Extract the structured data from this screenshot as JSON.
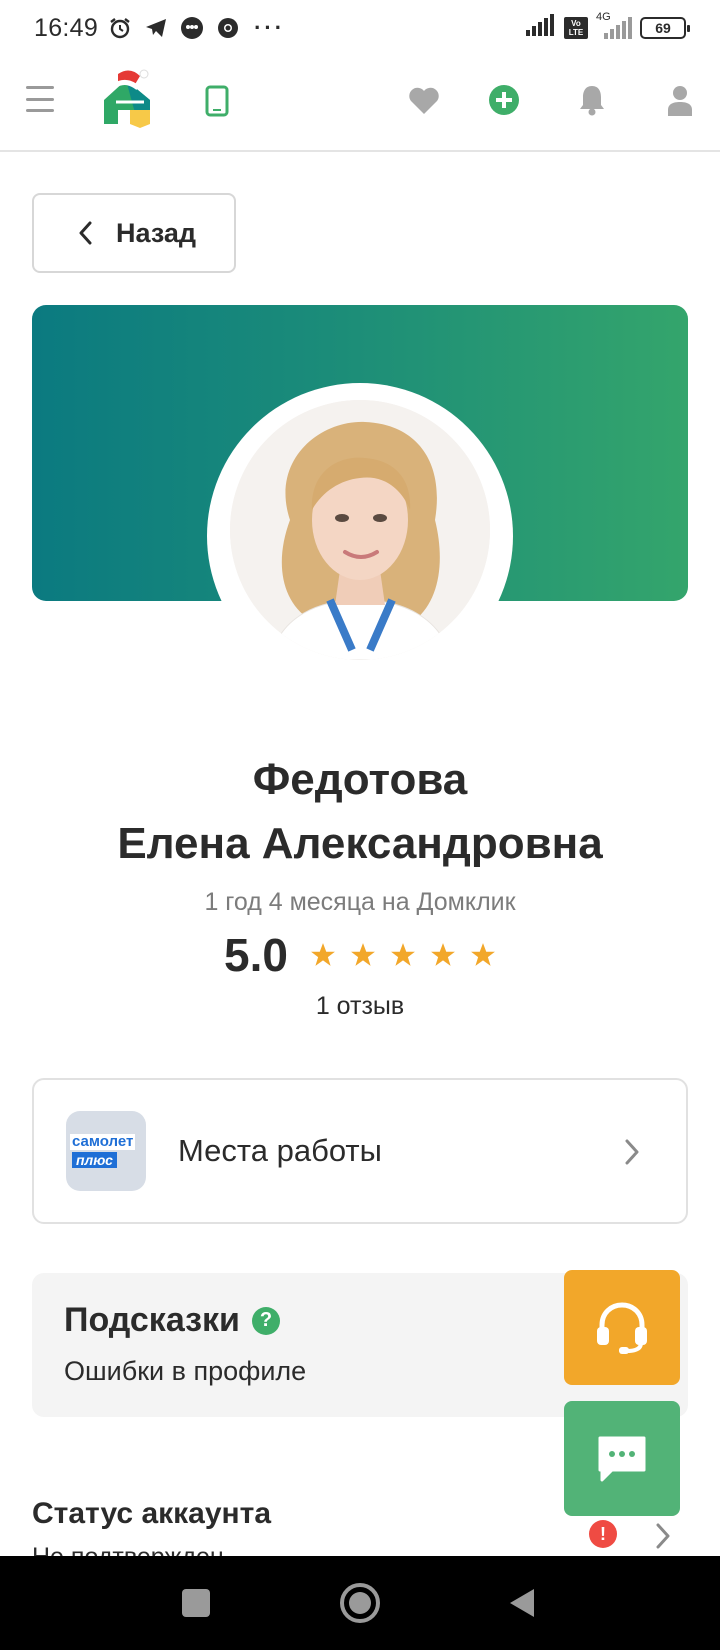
{
  "status_bar": {
    "time": "16:49",
    "icons": [
      "alarm-icon",
      "telegram-icon",
      "chat-bubble-icon",
      "chrome-icon"
    ],
    "more": "···",
    "network": "4G",
    "lte_line1": "Vo",
    "lte_line2": "LTE",
    "battery": "69"
  },
  "header": {
    "icons": [
      "menu-icon",
      "domclick-logo",
      "phone-icon",
      "heart-icon",
      "add-icon",
      "bell-icon",
      "user-icon"
    ],
    "colors": {
      "accent": "#3fae69"
    }
  },
  "back_button": {
    "label": "Назад"
  },
  "profile": {
    "last_name": "Федотова",
    "full_name": "Елена Александровна",
    "tenure": "1 год 4 месяца на Домклик",
    "rating": "5.0",
    "stars": 5,
    "reviews": "1 отзыв",
    "colors": {
      "banner_start": "#0b7a80",
      "banner_end": "#34a56c",
      "star": "#f2a72a"
    }
  },
  "workplaces": {
    "label": "Места работы",
    "company_logo_line1": "самолет",
    "company_logo_line2": "плюс"
  },
  "hints": {
    "title": "Подсказки",
    "help_icon": "?",
    "subtitle": "Ошибки в профиле"
  },
  "account_status": {
    "title": "Статус аккаунта",
    "value": "Не подтвержден",
    "alert": "!"
  },
  "fabs": {
    "support": {
      "icon": "headset-icon",
      "color": "#f2a72a"
    },
    "chat": {
      "icon": "chat-icon",
      "color": "#52b377"
    }
  },
  "nav_bar": {
    "icons": [
      "recents-icon",
      "home-icon",
      "back-icon"
    ]
  }
}
